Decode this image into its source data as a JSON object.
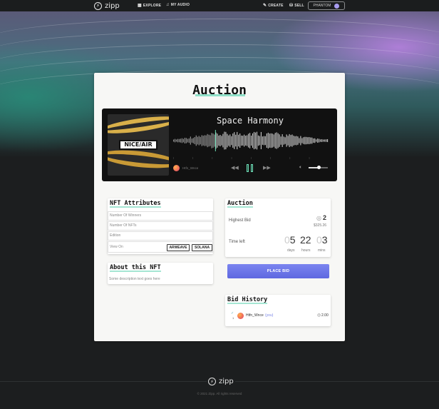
{
  "nav": {
    "brand": "zipp",
    "explore": "EXPLORE",
    "my_audio": "MY AUDIO",
    "create": "CREATE",
    "sell": "SELL",
    "wallet": "PHANTOM"
  },
  "page": {
    "title": "Auction"
  },
  "player": {
    "cover_label": "NICE/AIR",
    "track_title": "Space Harmony",
    "artist": "Htfn_Wnce",
    "progress": 0.27,
    "volume": 0.55
  },
  "attributes": {
    "title": "NFT Attributes",
    "rows": [
      "Number Of Winners",
      "Number Of NFTs",
      "Edition"
    ],
    "view_on_label": "View On",
    "arweave": "ARWEAVE",
    "solana": "SOLANA"
  },
  "about": {
    "title": "About this NFT",
    "description": "Some description text goes here"
  },
  "auction": {
    "title": "Auction",
    "highest_bid_label": "Highest Bid",
    "highest_bid_value": "2",
    "highest_bid_usd": "$325.26",
    "time_left_label": "Time left",
    "days_ghost": "0",
    "days": "5",
    "hours": "22",
    "mins_ghost": "0",
    "mins": "3",
    "days_label": "days",
    "hours_label": "hours",
    "mins_label": "mins",
    "place_bid": "PLACE BID"
  },
  "bid_history": {
    "title": "Bid History",
    "rows": [
      {
        "rank": "1",
        "user": "Htfn_Wnce",
        "you": "(you)",
        "amount": "2.00"
      }
    ]
  },
  "footer": {
    "brand": "zipp",
    "copyright": "© 2021 Zipp. All rights reserved"
  },
  "colors": {
    "accent_mint": "#8fe0c8",
    "button_blue": "#6670e6",
    "page_bg": "#1c1e1f"
  }
}
